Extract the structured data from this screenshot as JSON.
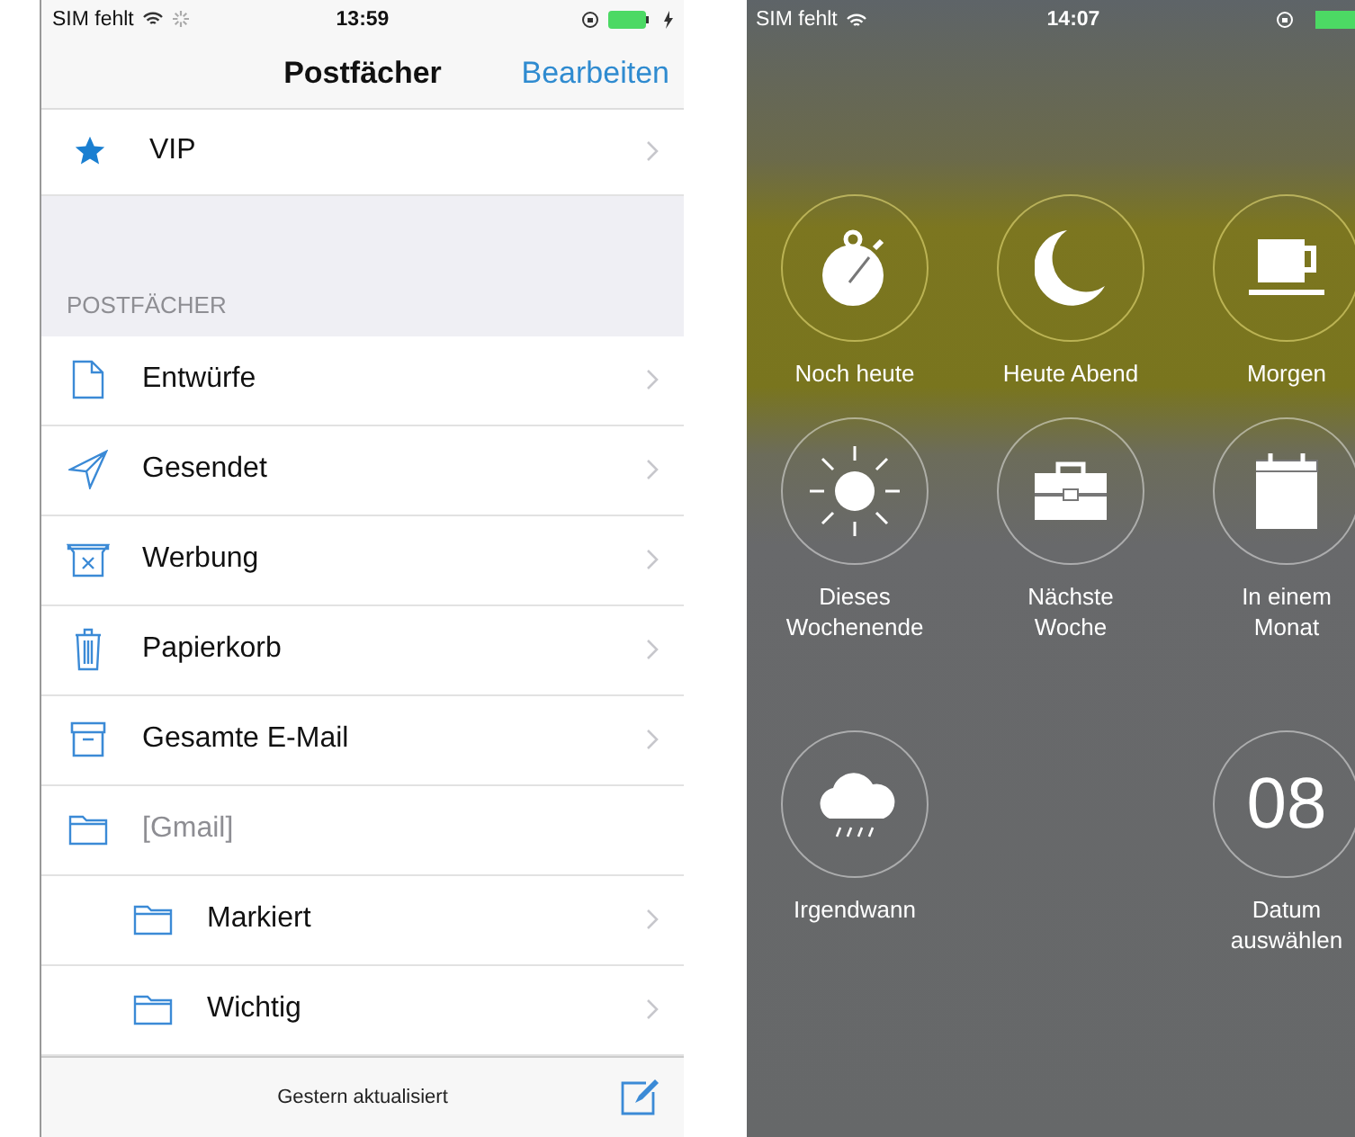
{
  "mail_screen": {
    "status_bar": {
      "carrier": "SIM fehlt",
      "time": "13:59",
      "charging": true
    },
    "nav_bar": {
      "title": "Postfächer",
      "action": "Bearbeiten"
    },
    "top_items": [
      {
        "label": "VIP",
        "kind": "star",
        "disabled": false
      }
    ],
    "section_header": "POSTFÄCHER",
    "mailboxes": [
      {
        "label": "Entwürfe",
        "kind": "draft",
        "disabled": false
      },
      {
        "label": "Gesendet",
        "kind": "sent",
        "disabled": false
      },
      {
        "label": "Werbung",
        "kind": "junk",
        "disabled": false
      },
      {
        "label": "Papierkorb",
        "kind": "trash",
        "disabled": false
      },
      {
        "label": "Gesamte E-Mail",
        "kind": "archive",
        "disabled": false
      },
      {
        "label": "[Gmail]",
        "kind": "folder",
        "disabled": true,
        "children": [
          {
            "label": "Markiert",
            "kind": "folder",
            "disabled": false
          },
          {
            "label": "Wichtig",
            "kind": "folder",
            "disabled": false
          }
        ]
      }
    ],
    "toolbar": {
      "status": "Gestern aktualisiert"
    }
  },
  "snooze_screen": {
    "status_bar": {
      "carrier": "SIM fehlt",
      "time": "14:07"
    },
    "options": [
      {
        "label": "Noch heute",
        "kind": "stopwatch"
      },
      {
        "label": "Heute Abend",
        "kind": "moon"
      },
      {
        "label": "Morgen",
        "kind": "cup"
      },
      {
        "label": "Dieses Wochenende",
        "kind": "sun"
      },
      {
        "label": "Nächste Woche",
        "kind": "briefcase"
      },
      {
        "label": "In einem Monat",
        "kind": "calendar"
      },
      {
        "label": "Irgendwann",
        "kind": "cloud"
      },
      {
        "label": "Datum auswählen",
        "kind": "date",
        "number": "08"
      }
    ]
  }
}
